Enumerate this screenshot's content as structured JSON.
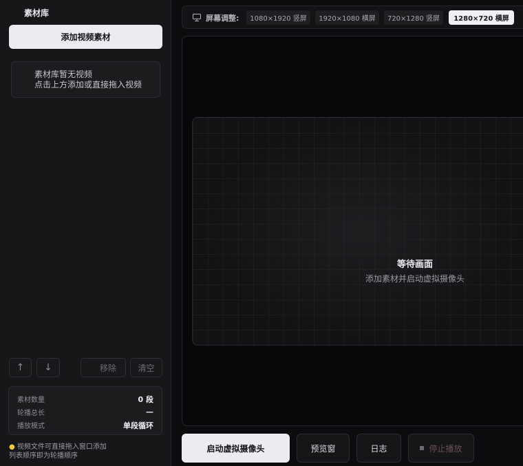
{
  "sidebar": {
    "title": "素材库",
    "add_button": "添加视频素材",
    "empty_line1": "素材库暂无视频",
    "empty_line2": "点击上方添加或直接拖入视频",
    "up_icon": "↑",
    "down_icon": "↓",
    "remove_button": "移除",
    "clear_button": "清空",
    "stats": [
      {
        "label": "素材数量",
        "value": "0 段"
      },
      {
        "label": "轮播总长",
        "value": "—"
      },
      {
        "label": "播放模式",
        "value": "单段循环"
      }
    ],
    "hint_line1": "视频文件可直接拖入窗口添加",
    "hint_line2": "列表顺序即为轮播顺序"
  },
  "topbar": {
    "label": "屏幕调整:",
    "resolutions": [
      "1080×1920 竖屏",
      "1920×1080 横屏",
      "720×1280 竖屏",
      "1280×720 横屏"
    ],
    "active_resolution": "1280×720 横屏"
  },
  "preview": {
    "title": "等待画面",
    "subtitle": "添加素材并启动虚拟摄像头"
  },
  "actions": {
    "start": "启动虚拟摄像头",
    "preview_window": "预览窗",
    "log": "日志",
    "stop": "停止播放"
  },
  "icons": {
    "monitor": "monitor-icon",
    "bulb": "lightbulb-icon",
    "stop": "stop-icon"
  }
}
